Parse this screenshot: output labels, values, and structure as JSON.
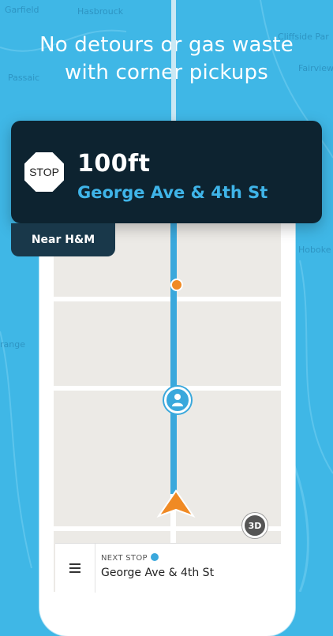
{
  "headline": {
    "line1": "No detours or gas waste",
    "line2": "with corner pickups"
  },
  "background_map": {
    "labels": [
      "Garfield",
      "Hasbrouck",
      "Passaic",
      "Cliffside Par",
      "Fairview",
      "Hoboke",
      "range"
    ]
  },
  "nav_card": {
    "sign_text": "STOP",
    "distance": "100ft",
    "street": "George Ave & 4th St",
    "near": "Near H&M"
  },
  "map": {
    "btn_3d": "3D"
  },
  "bottom_bar": {
    "menu_icon": "menu-icon",
    "next_stop_label": "NEXT STOP",
    "next_stop_address": "George Ave & 4th St"
  },
  "colors": {
    "background": "#3fb7e6",
    "card": "#0d2330",
    "accent": "#3aa8dc",
    "street_text": "#3fb4e8",
    "arrow": "#f08a24"
  }
}
